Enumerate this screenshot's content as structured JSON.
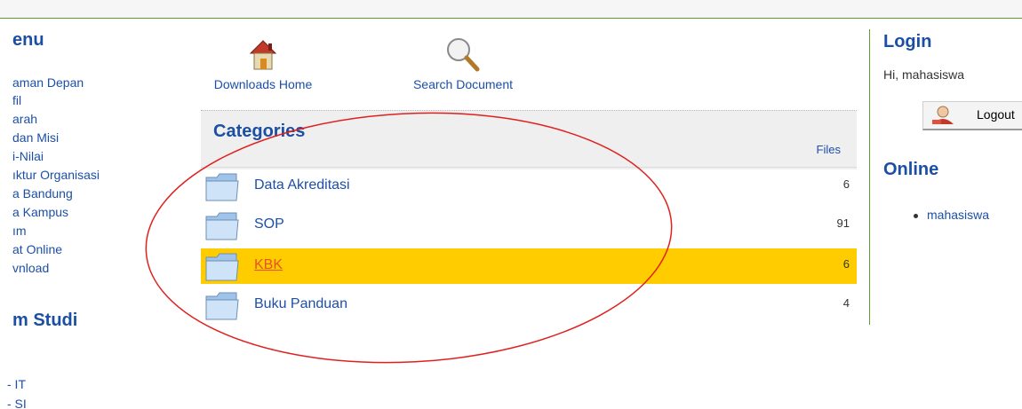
{
  "left_menu": {
    "title": "enu",
    "items": [
      {
        "label": "aman Depan"
      },
      {
        "label": "fil"
      },
      {
        "label": "arah"
      },
      {
        "label": "dan Misi"
      },
      {
        "label": "i-Nilai"
      },
      {
        "label": "ıktur Organisasi"
      },
      {
        "label": "a Bandung"
      },
      {
        "label": "a Kampus"
      },
      {
        "label": "ım"
      },
      {
        "label": "at Online"
      },
      {
        "label": "vnload"
      }
    ],
    "section2_title": "m Studi",
    "section2_items": [
      {
        "label": "- IT"
      },
      {
        "label": "- SI"
      }
    ]
  },
  "toolbar": {
    "home_label": "Downloads Home",
    "search_label": "Search Document"
  },
  "categories": {
    "title": "Categories",
    "files_header": "Files",
    "rows": [
      {
        "name": "Data Akreditasi",
        "count": "6"
      },
      {
        "name": "SOP",
        "count": "91"
      },
      {
        "name": "KBK",
        "count": "6"
      },
      {
        "name": "Buku Panduan",
        "count": "4"
      }
    ]
  },
  "login": {
    "title": "Login",
    "greeting": "Hi, mahasiswa",
    "logout_label": "Logout"
  },
  "online": {
    "title": "Online",
    "users": [
      "mahasiswa"
    ]
  },
  "colors": {
    "highlight": "#ffcc00",
    "accent": "#1a4fa3",
    "divider": "#5aa02c",
    "annotation": "#e0201e"
  }
}
